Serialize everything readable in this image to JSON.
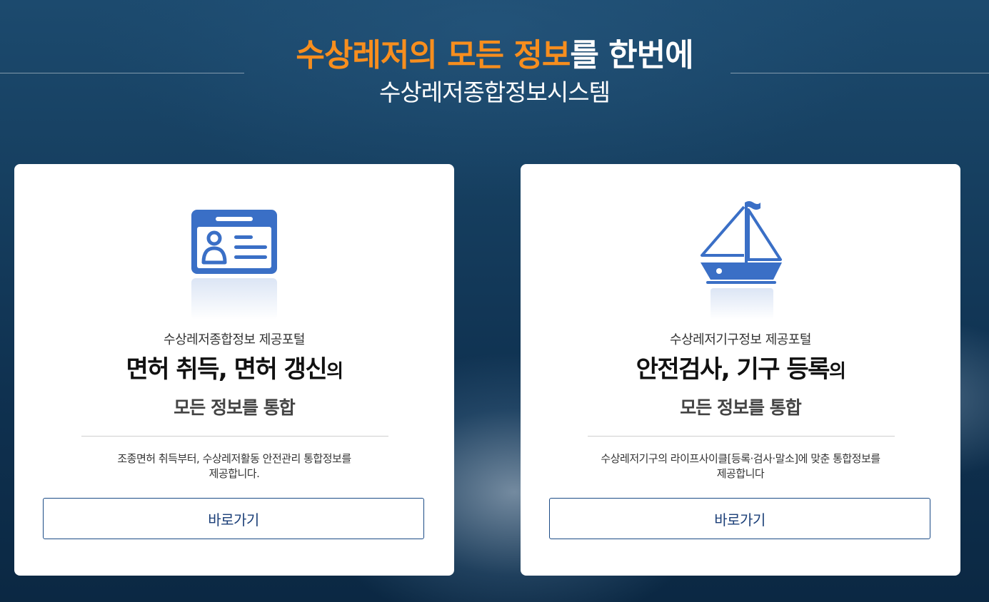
{
  "hero": {
    "title_accent": "수상레저의 모든 정보",
    "title_rest": "를 한번에",
    "subtitle": "수상레저종합정보시스템"
  },
  "cards": [
    {
      "icon": "id-card-icon",
      "kicker": "수상레저종합정보 제공포털",
      "title_main": "면허 취득, 면허 갱신",
      "title_suffix": "의",
      "title_line2": "모든 정보를 통합",
      "description_line1": "조종면허 취득부터, 수상레저활동 안전관리 통합정보를",
      "description_line2": "제공합니다.",
      "button_label": "바로가기"
    },
    {
      "icon": "sailboat-icon",
      "kicker": "수상레저기구정보 제공포털",
      "title_main": "안전검사, 기구 등록",
      "title_suffix": "의",
      "title_line2": "모든 정보를 통합",
      "description_line1": "수상레저기구의 라이프사이클[등록·검사·말소]에 맞춘 통합정보를",
      "description_line2": "제공합니다",
      "button_label": "바로가기"
    }
  ],
  "colors": {
    "accent": "#f78e1e",
    "icon_blue": "#3a6fc6",
    "button_border": "#1b4b86"
  }
}
